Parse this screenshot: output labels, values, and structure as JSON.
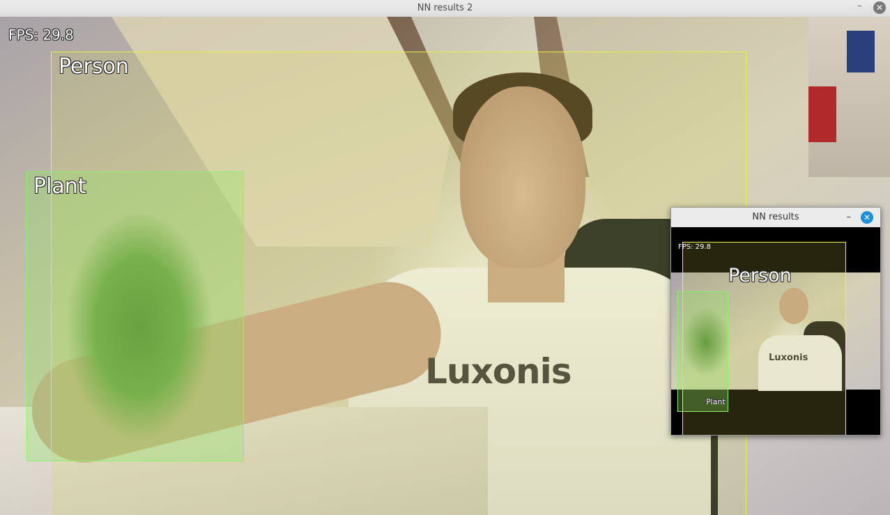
{
  "main_window": {
    "title": "NN results 2",
    "minimize_icon": "minimize-icon",
    "close_icon": "close-icon",
    "close_symbol": "✕",
    "minimize_symbol": "–"
  },
  "video": {
    "fps_label": "FPS:  29.8",
    "shirt_logo": "Luxonis",
    "detections": [
      {
        "label": "Person",
        "color": "#e9ef4a"
      },
      {
        "label": "Plant",
        "color": "#8ff06b"
      }
    ]
  },
  "mini_window": {
    "title": "NN results",
    "close_symbol": "✕",
    "minimize_symbol": "–",
    "fps_label": "FPS:  29.8",
    "shirt_logo": "Luxonis",
    "detections": [
      {
        "label": "Person"
      },
      {
        "label": "Plant"
      }
    ],
    "close_color": "#1e8fd9"
  }
}
